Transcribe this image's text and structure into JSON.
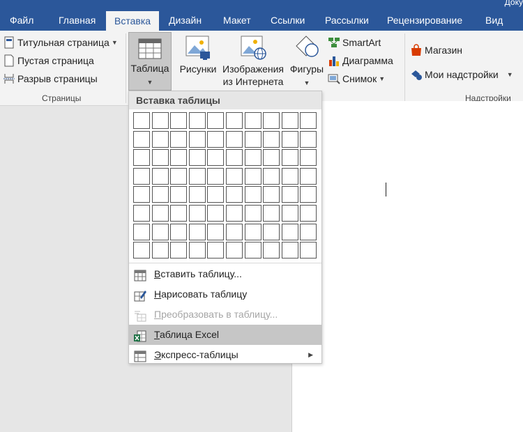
{
  "window": {
    "title_fragment": "Доку"
  },
  "tabs": [
    {
      "label": "Файл"
    },
    {
      "label": "Главная"
    },
    {
      "label": "Вставка"
    },
    {
      "label": "Дизайн"
    },
    {
      "label": "Макет"
    },
    {
      "label": "Ссылки"
    },
    {
      "label": "Рассылки"
    },
    {
      "label": "Рецензирование"
    },
    {
      "label": "Вид"
    }
  ],
  "ribbon": {
    "pages_group": {
      "label": "Страницы",
      "cover_page": "Титульная страница",
      "blank_page": "Пустая страница",
      "page_break": "Разрыв страницы"
    },
    "table_btn": "Таблица",
    "pictures_btn": "Рисунки",
    "online_pictures_line1": "Изображения",
    "online_pictures_line2": "из Интернета",
    "shapes_btn": "Фигуры",
    "smartart_btn": "SmartArt",
    "chart_btn": "Диаграмма",
    "screenshot_btn": "Снимок",
    "addins_group": {
      "label": "Надстройки",
      "store": "Магазин",
      "my_addins": "Мои надстройки"
    }
  },
  "dropdown": {
    "title": "Вставка таблицы",
    "grid": {
      "cols": 10,
      "rows": 8
    },
    "items": [
      {
        "label": "Вставить таблицу...",
        "accel": "В",
        "rest": "ставить таблицу..."
      },
      {
        "label": "Нарисовать таблицу",
        "accel": "Н",
        "rest": "арисовать таблицу"
      },
      {
        "label": "Преобразовать в таблицу...",
        "accel": "П",
        "rest": "реобразовать в таблицу..."
      },
      {
        "label": "Таблица Excel",
        "accel": "Т",
        "rest": "аблица Excel"
      },
      {
        "label": "Экспресс-таблицы",
        "accel": "Э",
        "rest": "кспресс-таблицы"
      }
    ]
  },
  "colors": {
    "accent": "#2b579a",
    "ribbon_bg": "#f3f3f3",
    "workspace_bg": "#e6e6e6",
    "excel_green": "#1e7145",
    "store_red": "#d83b01"
  }
}
